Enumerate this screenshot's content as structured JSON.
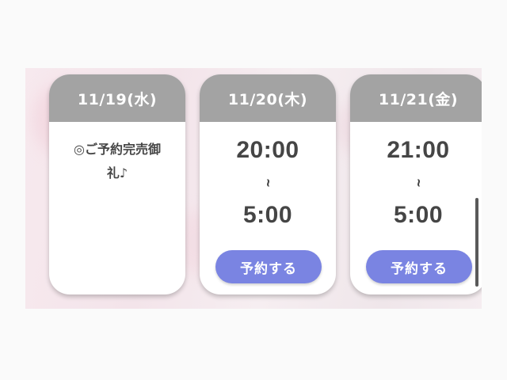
{
  "schedule": {
    "cards": [
      {
        "date": "11/19(水)",
        "status_lines": [
          "◎ご予約完売御",
          "礼♪"
        ]
      },
      {
        "date": "11/20(木)",
        "start_time": "20:00",
        "separator": "~",
        "end_time": "5:00",
        "button_label": "予約する"
      },
      {
        "date": "11/21(金)",
        "start_time": "21:00",
        "separator": "~",
        "end_time": "5:00",
        "button_label": "予約する"
      }
    ]
  },
  "colors": {
    "header_bg": "#a3a3a3",
    "button_bg": "#7a84e2",
    "text": "#454545"
  }
}
